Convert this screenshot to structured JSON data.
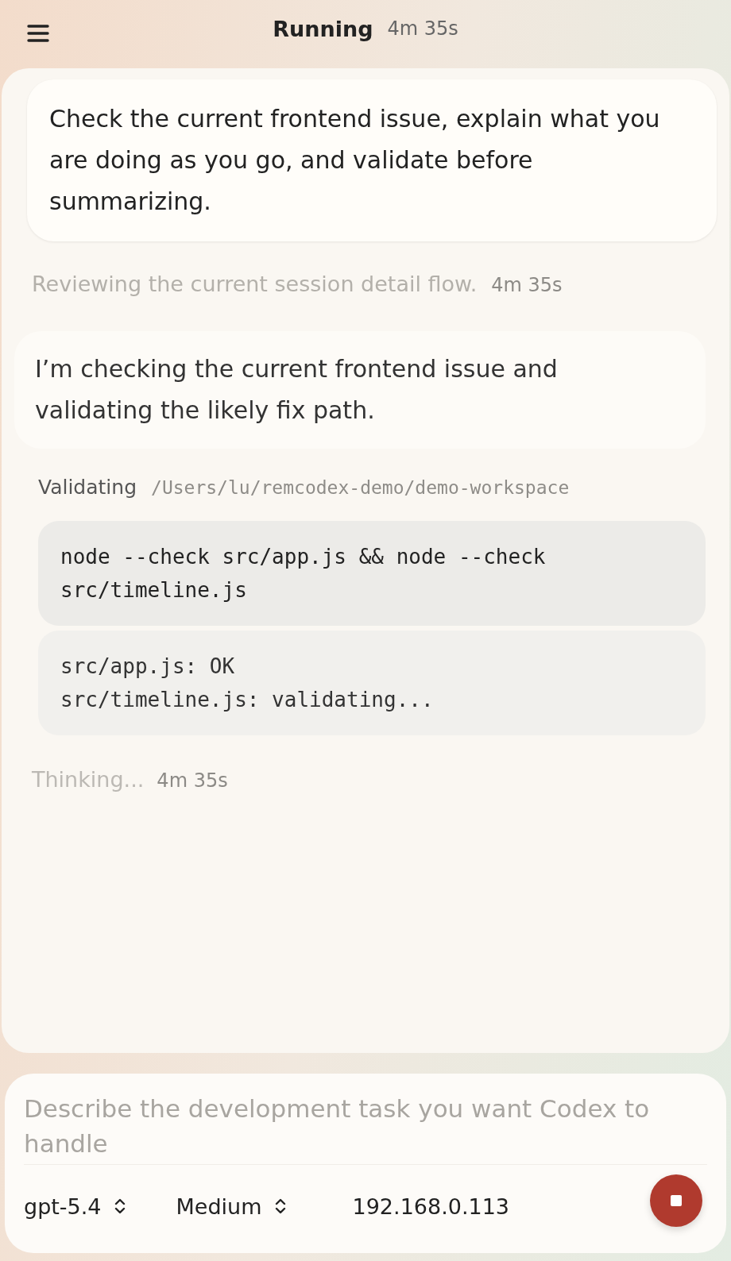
{
  "header": {
    "title": "Running",
    "elapsed": "4m 35s"
  },
  "user_message": "Check the current frontend issue, explain what you are doing as you go, and validate before summarizing.",
  "status_line": {
    "text": "Reviewing the current session detail flow.",
    "elapsed": "4m 35s"
  },
  "assistant_message": "I’m checking the current frontend issue and validating the likely fix path.",
  "command": {
    "label": "Validating",
    "path": "/Users/lu/remcodex-demo/demo-workspace",
    "code": "node --check src/app.js && node --check src/timeline.js",
    "output": [
      "src/app.js: OK",
      "src/timeline.js: validating..."
    ]
  },
  "thinking": {
    "text": "Thinking...",
    "elapsed": "4m 35s"
  },
  "composer": {
    "placeholder": "Describe the development task you want Codex to handle",
    "model": "gpt-5.4",
    "effort": "Medium",
    "host": "192.168.0.113"
  }
}
